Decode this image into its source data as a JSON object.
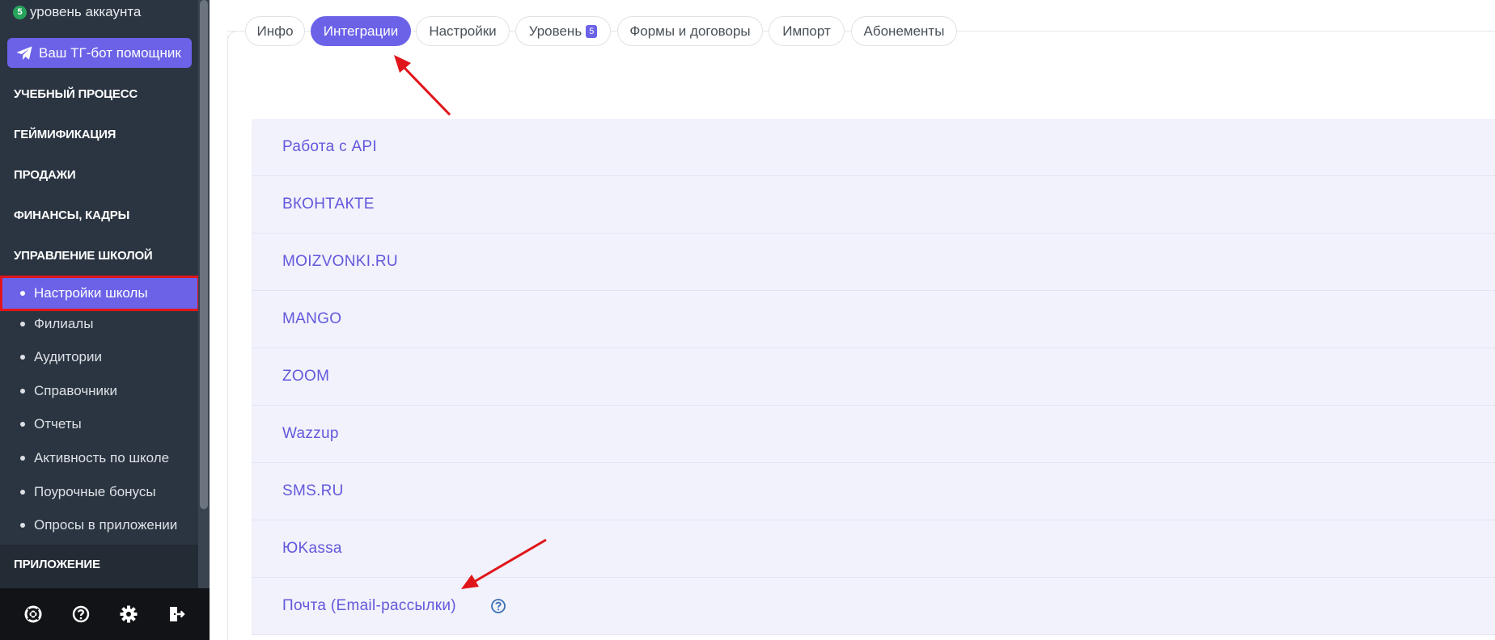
{
  "sidebar": {
    "account_level_badge": "5",
    "account_level_text": "уровень аккаунта",
    "tg_bot_button": "Ваш ТГ-бот помощник",
    "sections": {
      "learning": "УЧЕБНЫЙ ПРОЦЕСС",
      "gamification": "ГЕЙМИФИКАЦИЯ",
      "sales": "ПРОДАЖИ",
      "finance": "ФИНАНСЫ, КАДРЫ",
      "school_management": "УПРАВЛЕНИЕ ШКОЛОЙ",
      "app": "ПРИЛОЖЕНИЕ"
    },
    "school_items": [
      "Настройки школы",
      "Филиалы",
      "Аудитории",
      "Справочники",
      "Отчеты",
      "Активность по школе",
      "Поурочные бонусы",
      "Опросы в приложении"
    ],
    "footer_icons": [
      "lifebuoy-icon",
      "help-circle-icon",
      "gear-icon",
      "logout-icon"
    ]
  },
  "tabs": {
    "info": "Инфо",
    "integrations": "Интеграции",
    "settings": "Настройки",
    "level": "Уровень",
    "level_badge": "5",
    "forms": "Формы и договоры",
    "import": "Импорт",
    "subscriptions": "Абонементы",
    "active": "integrations"
  },
  "integrations": [
    "Работа с API",
    "ВКОНТАКТЕ",
    "MOIZVONKI.RU",
    "MANGO",
    "ZOOM",
    "Wazzup",
    "SMS.RU",
    "ЮKassa",
    "Почта (Email-рассылки)"
  ],
  "colors": {
    "sidebar_bg": "#2b3541",
    "accent": "#6b62e8",
    "highlight_border": "#e0151a",
    "row_bg": "#f1f2fb",
    "row_text": "#6358dc",
    "annotation_arrow": "#e0151a"
  }
}
